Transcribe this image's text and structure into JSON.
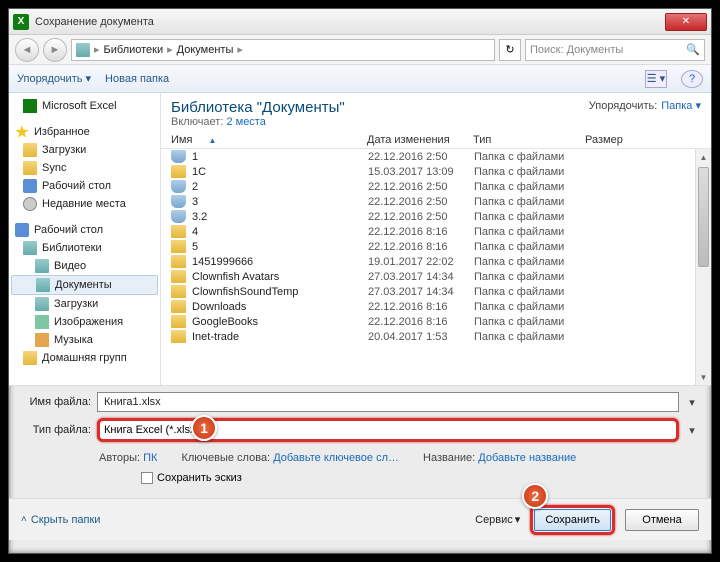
{
  "window": {
    "title": "Сохранение документа"
  },
  "breadcrumb": {
    "seg1": "Библиотеки",
    "seg2": "Документы"
  },
  "search": {
    "placeholder": "Поиск: Документы"
  },
  "toolbar": {
    "organize": "Упорядочить",
    "newfolder": "Новая папка"
  },
  "sidebar": {
    "excel": "Microsoft Excel",
    "fav": "Избранное",
    "downloads": "Загрузки",
    "sync": "Sync",
    "desktop": "Рабочий стол",
    "recent": "Недавние места",
    "desk2": "Рабочий стол",
    "libs": "Библиотеки",
    "video": "Видео",
    "docs": "Документы",
    "dl2": "Загрузки",
    "img": "Изображения",
    "music": "Музыка",
    "homegrp": "Домашняя групп"
  },
  "lib": {
    "title": "Библиотека \"Документы\"",
    "sub_pre": "Включает: ",
    "sub_link": "2 места",
    "org": "Упорядочить:",
    "orgval": "Папка"
  },
  "cols": {
    "name": "Имя",
    "date": "Дата изменения",
    "type": "Тип",
    "size": "Размер"
  },
  "rows": [
    {
      "ic": "db",
      "name": "1",
      "date": "22.12.2016 2:50",
      "type": "Папка с файлами"
    },
    {
      "ic": "folder",
      "name": "1C",
      "date": "15.03.2017 13:09",
      "type": "Папка с файлами"
    },
    {
      "ic": "db",
      "name": "2",
      "date": "22.12.2016 2:50",
      "type": "Папка с файлами"
    },
    {
      "ic": "db",
      "name": "3",
      "date": "22.12.2016 2:50",
      "type": "Папка с файлами"
    },
    {
      "ic": "db",
      "name": "3.2",
      "date": "22.12.2016 2:50",
      "type": "Папка с файлами"
    },
    {
      "ic": "folder",
      "name": "4",
      "date": "22.12.2016 8:16",
      "type": "Папка с файлами"
    },
    {
      "ic": "folder",
      "name": "5",
      "date": "22.12.2016 8:16",
      "type": "Папка с файлами"
    },
    {
      "ic": "folder",
      "name": "1451999666",
      "date": "19.01.2017 22:02",
      "type": "Папка с файлами"
    },
    {
      "ic": "folder",
      "name": "Clownfish Avatars",
      "date": "27.03.2017 14:34",
      "type": "Папка с файлами"
    },
    {
      "ic": "folder",
      "name": "ClownfishSoundTemp",
      "date": "27.03.2017 14:34",
      "type": "Папка с файлами"
    },
    {
      "ic": "folder",
      "name": "Downloads",
      "date": "22.12.2016 8:16",
      "type": "Папка с файлами"
    },
    {
      "ic": "folder",
      "name": "GoogleBooks",
      "date": "22.12.2016 8:16",
      "type": "Папка с файлами"
    },
    {
      "ic": "folder",
      "name": "Inet-trade",
      "date": "20.04.2017 1:53",
      "type": "Папка с файлами"
    }
  ],
  "filename": {
    "label": "Имя файла:",
    "value": "Книга1.xlsx"
  },
  "filetype": {
    "label": "Тип файла:",
    "value": "Книга Excel (*.xlsx)"
  },
  "meta": {
    "authors_l": "Авторы:",
    "authors_v": "ПК",
    "keywords_l": "Ключевые слова:",
    "keywords_v": "Добавьте ключевое сл…",
    "title_l": "Название:",
    "title_v": "Добавьте название"
  },
  "savesketch": "Сохранить эскиз",
  "footer": {
    "hide": "Скрыть папки",
    "service": "Сервис",
    "save": "Сохранить",
    "cancel": "Отмена"
  },
  "badges": {
    "one": "1",
    "two": "2"
  }
}
